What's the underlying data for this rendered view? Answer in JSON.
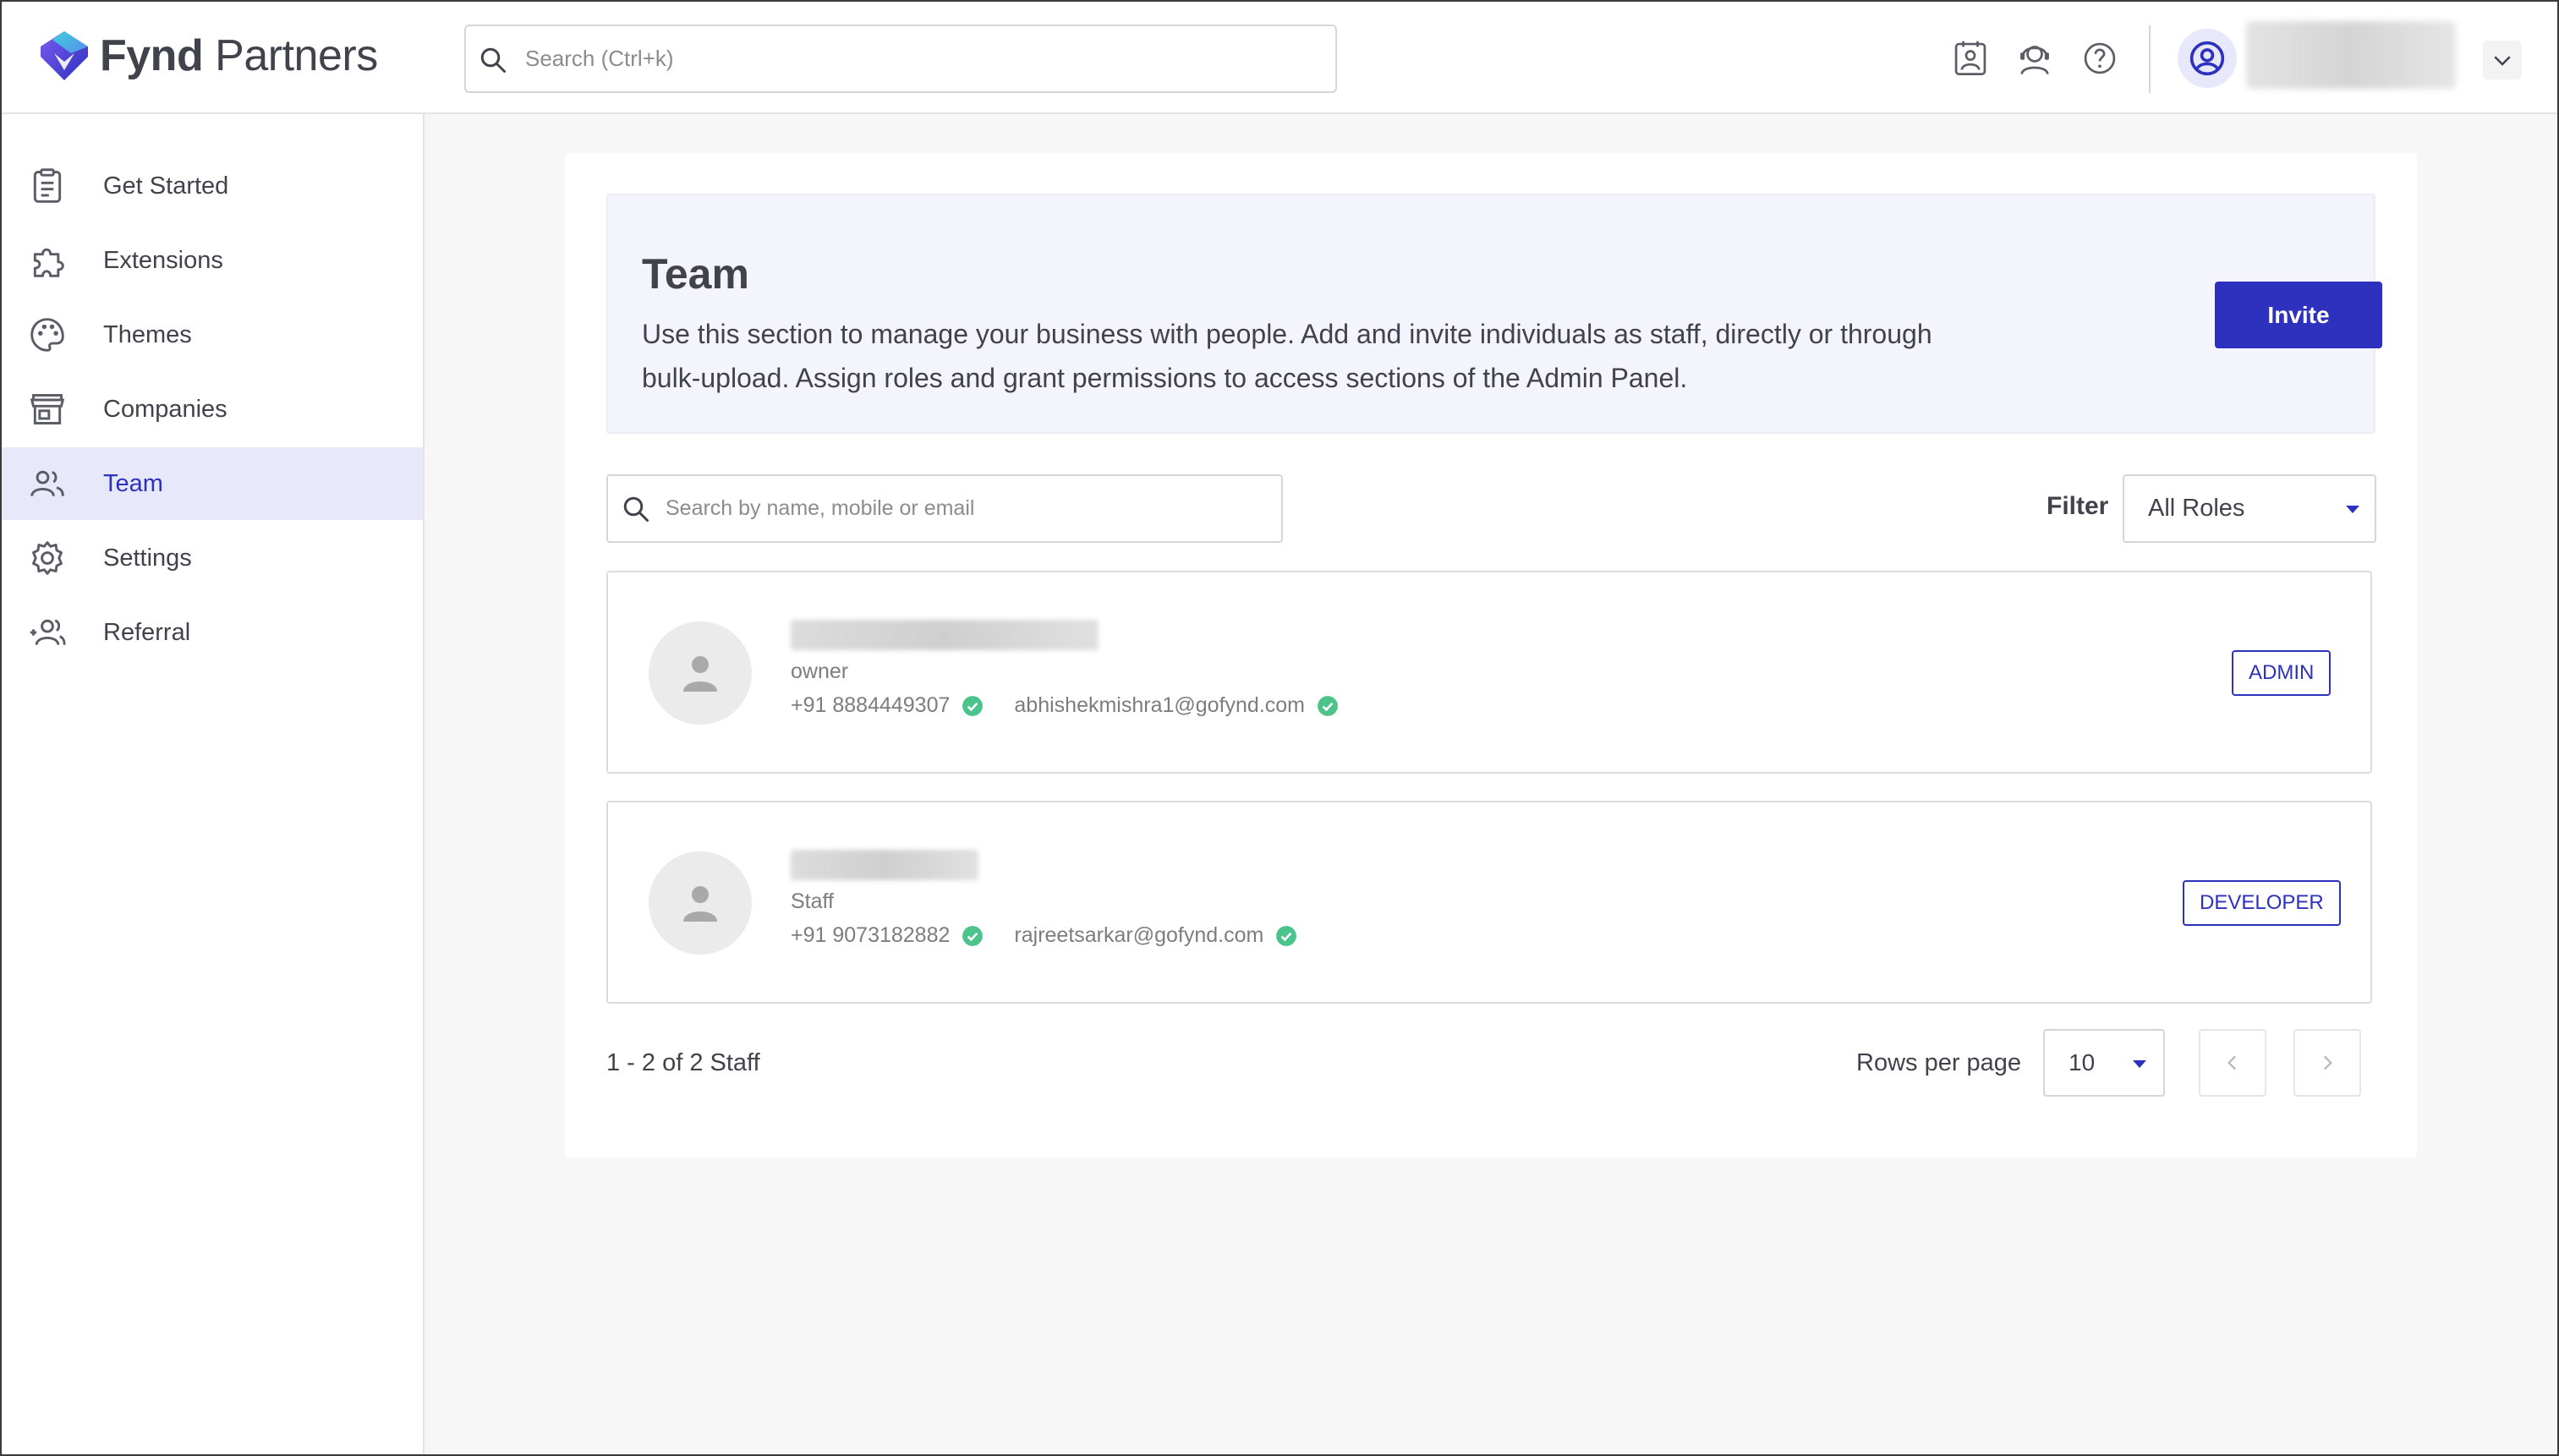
{
  "app": {
    "brand_bold": "Fynd",
    "brand_light": " Partners"
  },
  "header": {
    "search_placeholder": "Search (Ctrl+k)",
    "icons": [
      "calendar-user-icon",
      "support-headset-icon",
      "help-icon",
      "user-circle-icon",
      "chevron-down-icon"
    ]
  },
  "sidebar": {
    "items": [
      {
        "label": "Get Started",
        "icon": "clipboard-icon",
        "active": false
      },
      {
        "label": "Extensions",
        "icon": "puzzle-icon",
        "active": false
      },
      {
        "label": "Themes",
        "icon": "palette-icon",
        "active": false
      },
      {
        "label": "Companies",
        "icon": "store-icon",
        "active": false
      },
      {
        "label": "Team",
        "icon": "people-icon",
        "active": true
      },
      {
        "label": "Settings",
        "icon": "gear-icon",
        "active": false
      },
      {
        "label": "Referral",
        "icon": "user-add-icon",
        "active": false
      }
    ]
  },
  "team": {
    "title": "Team",
    "description": "Use this section to manage your business with people. Add and invite individuals as staff, directly or through bulk-upload. Assign roles and grant permissions to access sections of the Admin Panel.",
    "invite_label": "Invite",
    "search_placeholder": "Search by name, mobile or email",
    "filter_label": "Filter",
    "filter_value": "All Roles",
    "members": [
      {
        "role": "owner",
        "phone": "+91 8884449307",
        "email": "abhishekmishra1@gofynd.com",
        "badge": "ADMIN"
      },
      {
        "role": "Staff",
        "phone": "+91 9073182882",
        "email": "rajreetsarkar@gofynd.com",
        "badge": "DEVELOPER"
      }
    ],
    "pagination": {
      "summary": "1 - 2 of 2 Staff",
      "rows_label": "Rows per page",
      "rows_value": "10"
    }
  },
  "colors": {
    "accent": "#2e31be",
    "active_bg": "#e7e9fb",
    "verified": "#4cc38a"
  }
}
